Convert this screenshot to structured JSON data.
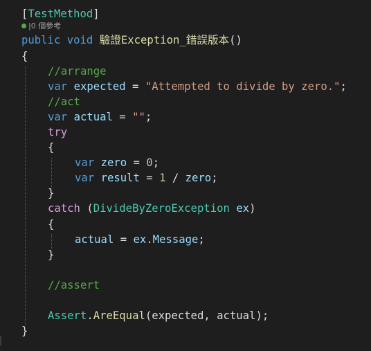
{
  "attribute": {
    "open": "[",
    "name": "TestMethod",
    "close": "]"
  },
  "codelens": {
    "references": "0 個參考"
  },
  "method": {
    "mod1": "public",
    "mod2": "void",
    "name": "驗證Exception_錯誤版本",
    "params": "()"
  },
  "code": {
    "open_brace": "{",
    "close_brace": "}",
    "comment_arrange": "//arrange",
    "var_kw": "var",
    "expected_name": "expected",
    "assign": " = ",
    "expected_value": "\"Attempted to divide by zero.\"",
    "semicolon": ";",
    "comment_act": "//act",
    "actual_name": "actual",
    "empty_string": "\"\"",
    "try_kw": "try",
    "zero_name": "zero",
    "zero_value": "0",
    "result_name": "result",
    "one_value": "1",
    "divide_op": " / ",
    "catch_kw": "catch",
    "catch_open": " (",
    "exception_type": "DivideByZeroException",
    "ex_name": "ex",
    "catch_close": ")",
    "message_access": "ex.Message",
    "comment_assert": "//assert",
    "assert_class": "Assert",
    "dot": ".",
    "assert_method": "AreEqual",
    "assert_args": "(expected, actual);"
  },
  "colors": {
    "background": "#1e1e1e",
    "keyword": "#569cd6",
    "control": "#d8a0df",
    "string": "#d69d85",
    "comment": "#57a64a",
    "number": "#b5cea8",
    "type": "#4ec9b0",
    "method": "#dcdcaa",
    "text": "#dcdcdc"
  }
}
